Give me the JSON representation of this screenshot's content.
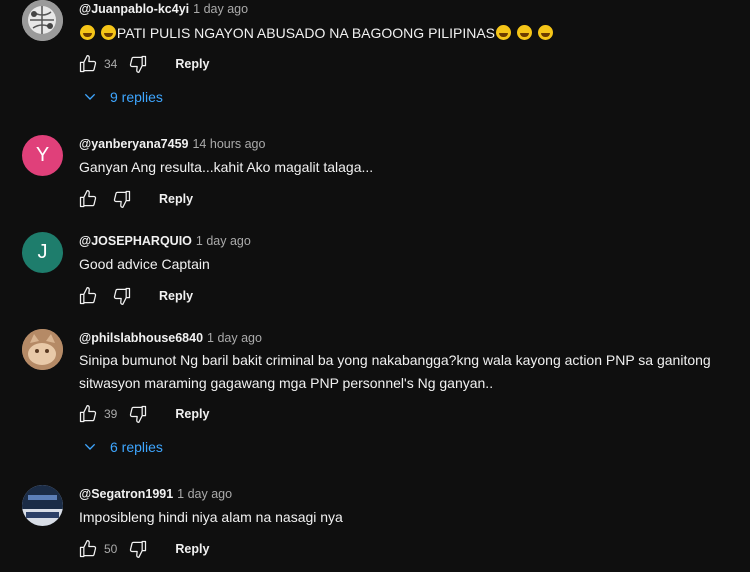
{
  "comments": [
    {
      "author": "@Juanpablo-kc4yi",
      "time": "1 day ago",
      "text_before": "",
      "text_main": "PATI PULIS NGAYON ABUSADO NA BAGOONG PILIPINAS",
      "likes": "34",
      "reply_label": "Reply",
      "replies_label": "9 replies",
      "avatar_icon": "globe-photo-icon"
    },
    {
      "author": "@yanberyana7459",
      "time": "14 hours ago",
      "text": "Ganyan Ang resulta...kahit Ako magalit talaga...",
      "likes": "",
      "reply_label": "Reply",
      "avatar_letter": "Y",
      "avatar_color": "#e0407a"
    },
    {
      "author": "@JOSEPHARQUIO",
      "time": "1 day ago",
      "text": "Good advice Captain",
      "likes": "",
      "reply_label": "Reply",
      "avatar_letter": "J",
      "avatar_color": "#1e7d6c"
    },
    {
      "author": "@philslabhouse6840",
      "time": "1 day ago",
      "text_line1": "Sinipa bumunot Ng baril bakit criminal ba yong nakabangga?kng wala kayong action PNP sa ganitong",
      "text_line2": "sitwasyon maraming gagawang mga PNP personnel's Ng ganyan..",
      "likes": "39",
      "reply_label": "Reply",
      "replies_label": "6 replies",
      "avatar_icon": "cat-photo-icon"
    },
    {
      "author": "@Segatron1991",
      "time": "1 day ago",
      "text": "Imposibleng hindi niya alam na nasagi nya",
      "likes": "50",
      "reply_label": "Reply",
      "avatar_icon": "logo-photo-icon"
    }
  ],
  "colors": {
    "background": "#0f0f0f",
    "link": "#3ea6ff",
    "meta": "#aaaaaa"
  }
}
